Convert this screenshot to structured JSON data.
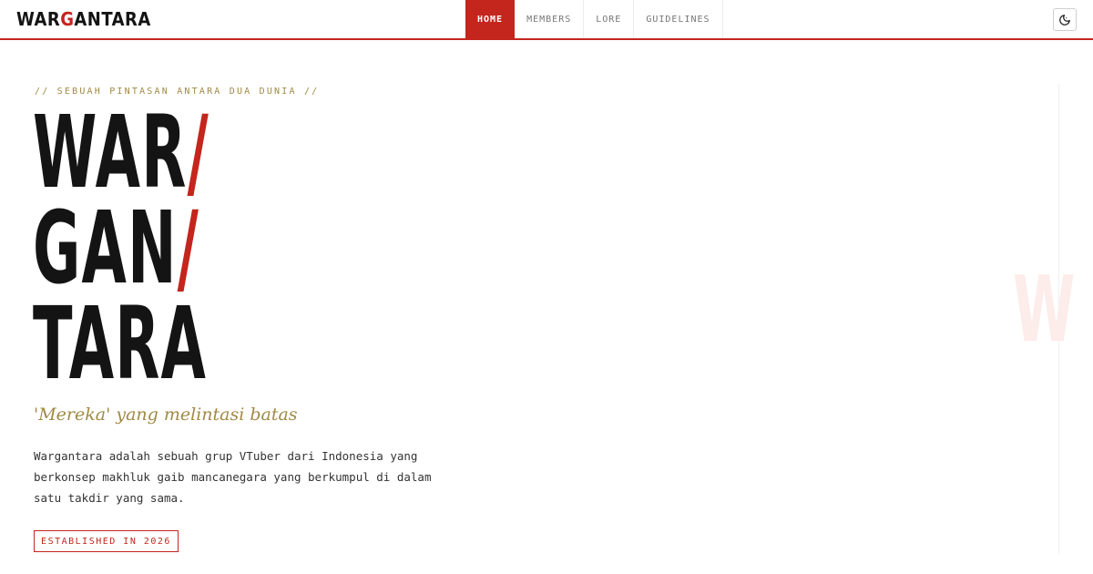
{
  "header": {
    "logo_prefix": "WAR",
    "logo_accent": "G",
    "logo_suffix": "ANTARA",
    "nav": [
      {
        "label": "HOME",
        "active": true
      },
      {
        "label": "MEMBERS",
        "active": false
      },
      {
        "label": "LORE",
        "active": false
      },
      {
        "label": "GUIDELINES",
        "active": false
      }
    ],
    "theme_toggle_icon": "moon-icon"
  },
  "hero": {
    "eyebrow": "// SEBUAH PINTASAN ANTARA DUA DUNIA //",
    "title_lines": [
      {
        "text": "WAR",
        "slash": "/"
      },
      {
        "text": "GAN",
        "slash": "/"
      },
      {
        "text": "TARA",
        "slash": ""
      }
    ],
    "tagline": "'Mereka' yang melintasi batas",
    "description": "Wargantara adalah sebuah grup VTuber dari Indonesia yang berkonsep makhluk gaib mancanegara yang berkumpul di dalam satu takdir yang sama.",
    "badge": "ESTABLISHED IN 2026"
  },
  "decoration": {
    "ghost_letter": "W"
  },
  "colors": {
    "accent": "#c4251d",
    "gold": "#a08a45",
    "text": "#141414"
  }
}
